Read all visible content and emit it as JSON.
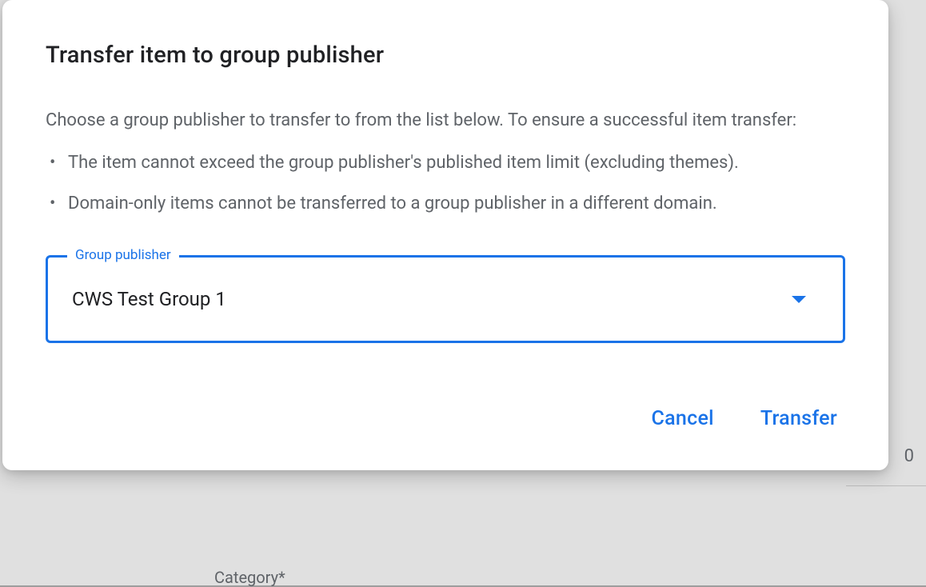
{
  "dialog": {
    "title": "Transfer item to group publisher",
    "description": "Choose a group publisher to transfer to from the list below. To ensure a successful item transfer:",
    "bullets": [
      "The item cannot exceed the group publisher's published item limit (excluding themes).",
      "Domain-only items cannot be transferred to a group publisher in a different domain."
    ],
    "select": {
      "label": "Group publisher",
      "value": "CWS Test Group 1"
    },
    "actions": {
      "cancel": "Cancel",
      "confirm": "Transfer"
    }
  },
  "background": {
    "category_label": "Category*",
    "value": "0"
  }
}
